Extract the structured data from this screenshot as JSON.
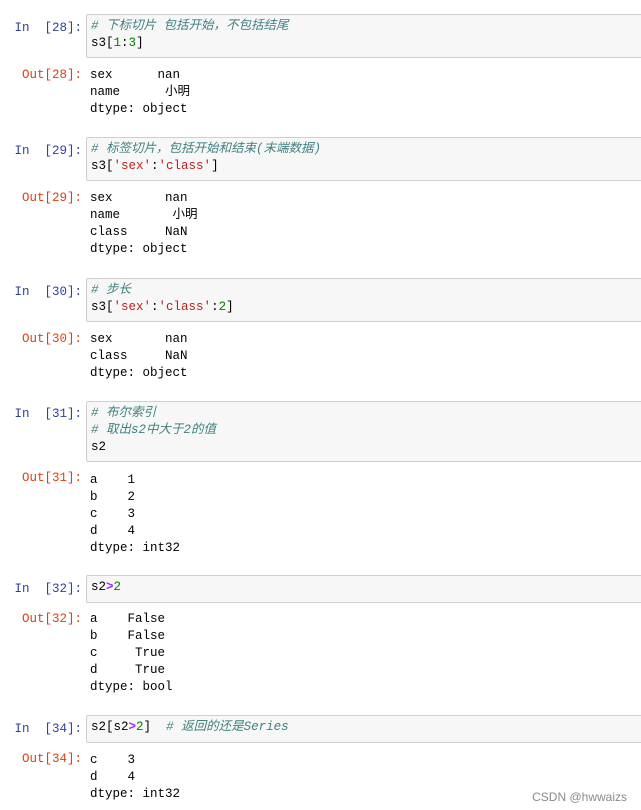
{
  "cells": [
    {
      "in_prompt": "In  [28]:",
      "out_prompt": "Out[28]:",
      "input": [
        [
          {
            "t": "# 下标切片 包括开始，不包括结尾",
            "c": "comment"
          }
        ],
        [
          {
            "t": "s3[",
            "c": ""
          },
          {
            "t": "1",
            "c": "num"
          },
          {
            "t": ":",
            "c": ""
          },
          {
            "t": "3",
            "c": "num"
          },
          {
            "t": "]",
            "c": ""
          }
        ]
      ],
      "output": [
        "sex      nan",
        "name      小明",
        "dtype: object"
      ]
    },
    {
      "in_prompt": "In  [29]:",
      "out_prompt": "Out[29]:",
      "input": [
        [
          {
            "t": "# 标签切片，包括开始和结束(末端数据)",
            "c": "comment"
          }
        ],
        [
          {
            "t": "s3[",
            "c": ""
          },
          {
            "t": "'sex'",
            "c": "str"
          },
          {
            "t": ":",
            "c": ""
          },
          {
            "t": "'class'",
            "c": "str"
          },
          {
            "t": "]",
            "c": ""
          }
        ]
      ],
      "output": [
        "sex       nan",
        "name       小明",
        "class     NaN",
        "dtype: object"
      ]
    },
    {
      "in_prompt": "In  [30]:",
      "out_prompt": "Out[30]:",
      "input": [
        [
          {
            "t": "# 步长",
            "c": "comment"
          }
        ],
        [
          {
            "t": "s3[",
            "c": ""
          },
          {
            "t": "'sex'",
            "c": "str"
          },
          {
            "t": ":",
            "c": ""
          },
          {
            "t": "'class'",
            "c": "str"
          },
          {
            "t": ":",
            "c": ""
          },
          {
            "t": "2",
            "c": "num"
          },
          {
            "t": "]",
            "c": ""
          }
        ]
      ],
      "output": [
        "sex       nan",
        "class     NaN",
        "dtype: object"
      ]
    },
    {
      "in_prompt": "In  [31]:",
      "out_prompt": "Out[31]:",
      "input": [
        [
          {
            "t": "# 布尔索引",
            "c": "comment"
          }
        ],
        [
          {
            "t": "# 取出s2中大于2的值",
            "c": "comment"
          }
        ],
        [
          {
            "t": "s2",
            "c": ""
          }
        ]
      ],
      "output": [
        "a    1",
        "b    2",
        "c    3",
        "d    4",
        "dtype: int32"
      ]
    },
    {
      "in_prompt": "In  [32]:",
      "out_prompt": "Out[32]:",
      "input": [
        [
          {
            "t": "s2",
            "c": ""
          },
          {
            "t": ">",
            "c": "op"
          },
          {
            "t": "2",
            "c": "num"
          }
        ]
      ],
      "output": [
        "a    False",
        "b    False",
        "c     True",
        "d     True",
        "dtype: bool"
      ]
    },
    {
      "in_prompt": "In  [34]:",
      "out_prompt": "Out[34]:",
      "input": [
        [
          {
            "t": "s2[s2",
            "c": ""
          },
          {
            "t": ">",
            "c": "op"
          },
          {
            "t": "2",
            "c": "num"
          },
          {
            "t": "]  ",
            "c": ""
          },
          {
            "t": "# 返回的还是Series",
            "c": "comment"
          }
        ]
      ],
      "output": [
        "c    3",
        "d    4",
        "dtype: int32"
      ]
    }
  ],
  "watermark": "CSDN @hwwaizs",
  "colors": {
    "in_prompt": "#303f9f",
    "out_prompt": "#d84315",
    "comment": "#408080",
    "string": "#ba2121",
    "number": "#008000",
    "operator": "#aa22ff"
  }
}
